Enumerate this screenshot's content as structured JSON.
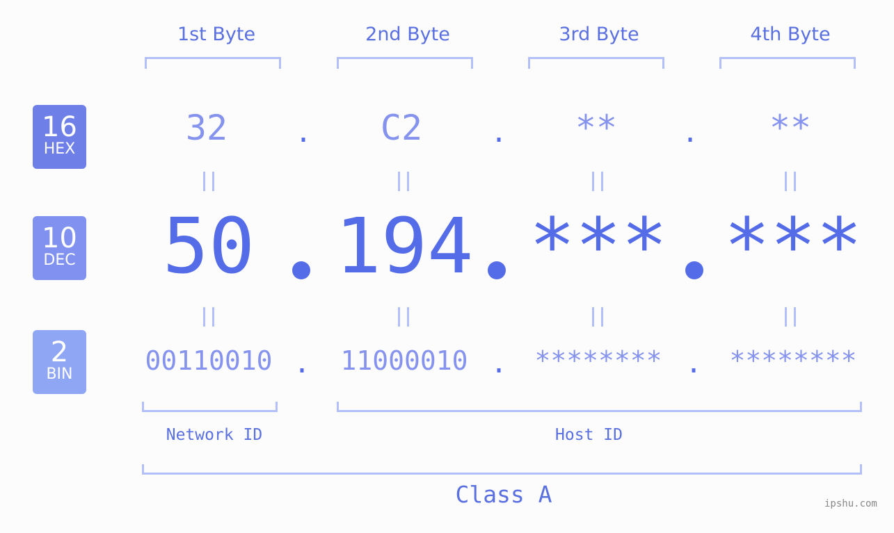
{
  "byte_headers": [
    "1st Byte",
    "2nd Byte",
    "3rd Byte",
    "4th Byte"
  ],
  "badges": [
    {
      "number": "16",
      "label": "HEX",
      "color": "#6f7fe8"
    },
    {
      "number": "10",
      "label": "DEC",
      "color": "#8191f0"
    },
    {
      "number": "2",
      "label": "BIN",
      "color": "#8fa6f5"
    }
  ],
  "hex": [
    "32",
    "C2",
    "**",
    "**"
  ],
  "dec": [
    "50",
    "194",
    "***",
    "***"
  ],
  "bin": [
    "00110010",
    "11000010",
    "********",
    "********"
  ],
  "separator": ".",
  "equals_symbol": "||",
  "network_id_label": "Network ID",
  "host_id_label": "Host ID",
  "class_label": "Class A",
  "watermark": "ipshu.com",
  "colors": {
    "accent": "#556ce8",
    "light": "#b3bff7",
    "mid": "#8593ee"
  }
}
